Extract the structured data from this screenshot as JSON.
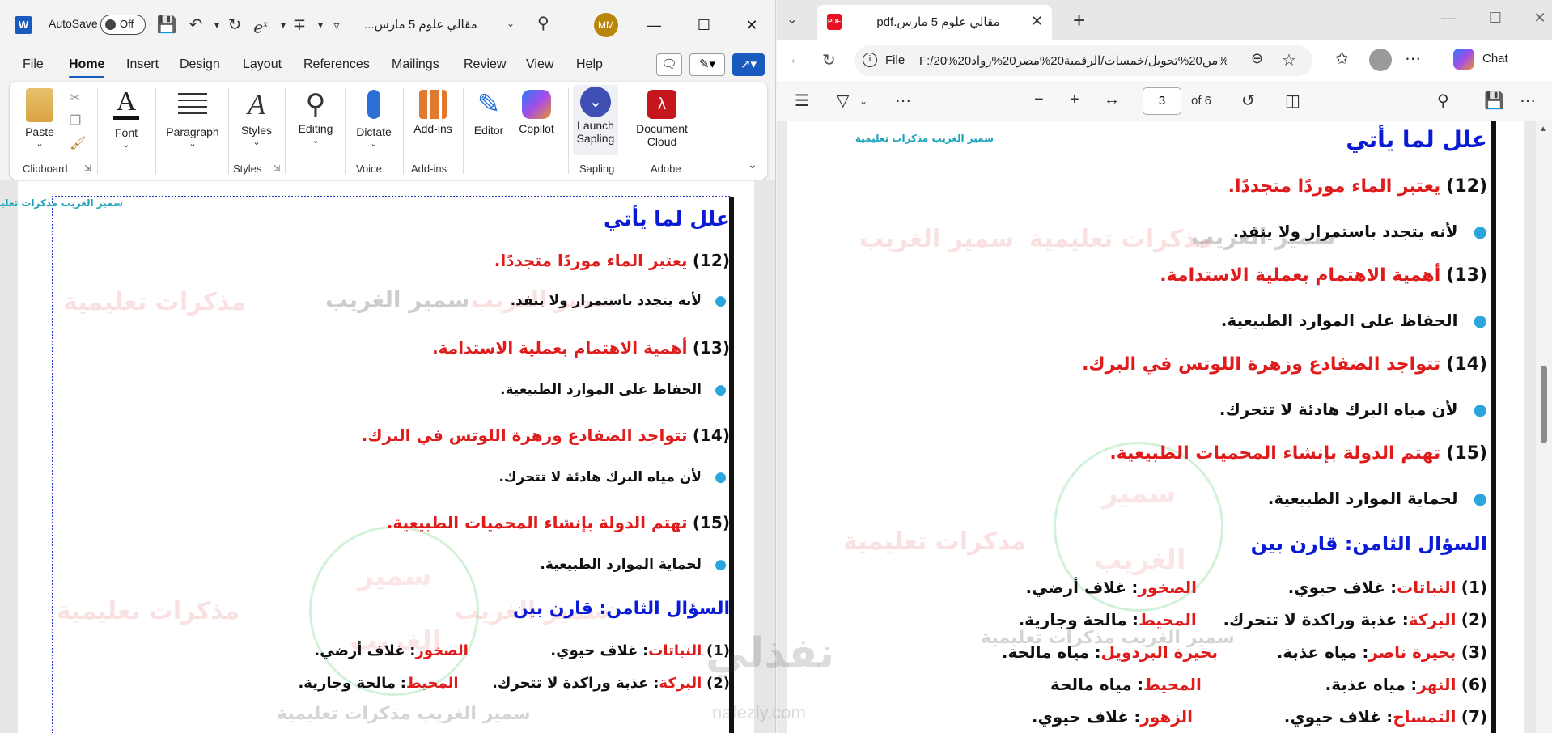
{
  "word": {
    "autosave_label": "AutoSave",
    "autosave_state": "Off",
    "doc_title": "مقالي علوم 5 مارس...",
    "avatar": "MM",
    "tabs": [
      "File",
      "Home",
      "Insert",
      "Design",
      "Layout",
      "References",
      "Mailings",
      "Review",
      "View",
      "Help"
    ],
    "ribbon": {
      "paste": "Paste",
      "font": "Font",
      "paragraph": "Paragraph",
      "styles": "Styles",
      "editing": "Editing",
      "dictate": "Dictate",
      "addins": "Add-ins",
      "editor": "Editor",
      "copilot": "Copilot",
      "sapling_l1": "Launch",
      "sapling_l2": "Sapling",
      "doccloud_l1": "Document",
      "doccloud_l2": "Cloud",
      "groups": {
        "clipboard": "Clipboard",
        "styles": "Styles",
        "voice": "Voice",
        "addins": "Add-ins",
        "sapling": "Sapling",
        "adobe": "Adobe"
      }
    },
    "page": {
      "header_small": "سمير الغريب مذكرات تعليمية",
      "heading": "علل لما يأتي",
      "items": [
        {
          "num": "(12)",
          "q": "يعتبر الماء موردًا متجددًا.",
          "a": "لأنه يتجدد باستمرار ولا ينفد."
        },
        {
          "num": "(13)",
          "q": "أهمية الاهتمام بعملية الاستدامة.",
          "a": "الحفاظ على الموارد الطبيعية."
        },
        {
          "num": "(14)",
          "q": "تتواجد الضفادع وزهرة اللوتس في البرك.",
          "a": "لأن مياه البرك هادئة لا تتحرك."
        },
        {
          "num": "(15)",
          "q": "تهتم الدولة بإنشاء المحميات الطبيعية.",
          "a": "لحماية الموارد الطبيعية."
        }
      ],
      "q8_title": "السؤال الثامن: قارن بين",
      "compare": [
        {
          "num": "(1)",
          "a_key": "النباتات",
          "a_val": "غلاف حيوي.",
          "b_key": "الصخور",
          "b_val": "غلاف أرضي."
        },
        {
          "num": "(2)",
          "a_key": "البركة",
          "a_val": "عذبة وراكدة لا تتحرك.",
          "b_key": "المحيط",
          "b_val": "مالحة وجارية."
        }
      ],
      "wm_name": "سمير الغريب",
      "wm_notes": "مذكرات تعليمية",
      "wm_circle_1": "سمير",
      "wm_circle_2": "الغريب"
    }
  },
  "edge": {
    "tab_title": "مقالي علوم 5 مارس.pdf",
    "url_scheme": "File",
    "url": "F:/20%من20%تحويل/خمسات/الرقمية20%مصر20%رواد20%word%2...",
    "chat": "Chat",
    "page_current": "3",
    "page_total": "of 6",
    "page": {
      "header_small": "سمير الغريب مذكرات تعليمية",
      "heading": "علل لما يأتي",
      "items": [
        {
          "num": "(12)",
          "q": "يعتبر الماء موردًا متجددًا.",
          "a": "لأنه يتجدد باستمرار ولا ينفد."
        },
        {
          "num": "(13)",
          "q": "أهمية الاهتمام بعملية الاستدامة.",
          "a": "الحفاظ على الموارد الطبيعية."
        },
        {
          "num": "(14)",
          "q": "تتواجد الضفادع وزهرة اللوتس في البرك.",
          "a": "لأن مياه البرك هادئة لا تتحرك."
        },
        {
          "num": "(15)",
          "q": "تهتم الدولة بإنشاء المحميات الطبيعية.",
          "a": "لحماية الموارد الطبيعية."
        }
      ],
      "q8_title": "السؤال الثامن: قارن بين",
      "compare": [
        {
          "num": "(1)",
          "a_key": "النباتات",
          "a_val": "غلاف حيوي.",
          "b_key": "الصخور",
          "b_val": "غلاف أرضي."
        },
        {
          "num": "(2)",
          "a_key": "البركة",
          "a_val": "عذبة وراكدة لا تتحرك.",
          "b_key": "المحيط",
          "b_val": "مالحة وجارية."
        },
        {
          "num": "(3)",
          "a_key": "بحيرة ناصر",
          "a_val": "مياه عذبة.",
          "b_key": "بحيرة البردويل",
          "b_val": "مياه مالحة."
        },
        {
          "num": "(6)",
          "a_key": "النهر",
          "a_val": "مياه عذبة.",
          "b_key": "المحيط",
          "b_val": "مياه مالحة"
        },
        {
          "num": "(7)",
          "a_key": "التمساح",
          "a_val": "غلاف حيوي.",
          "b_key": "الزهور",
          "b_val": "غلاف حيوي."
        }
      ],
      "wm_name": "سمير الغريب",
      "wm_notes": "مذكرات تعليمية",
      "wm_circle_1": "سمير",
      "wm_circle_2": "الغريب"
    }
  },
  "overlay": {
    "brand": "نفذلي",
    "brand_url": "nafezly.com"
  },
  "colors": {
    "word_accent": "#185abd",
    "heading_blue": "#0a1bd6",
    "question_red": "#e01b1b",
    "bullet_cyan": "#2aa6dd"
  }
}
